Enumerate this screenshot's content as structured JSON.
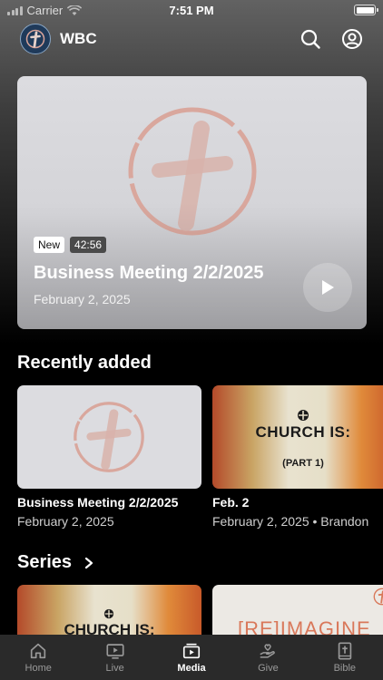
{
  "status_bar": {
    "carrier": "Carrier",
    "time": "7:51 PM"
  },
  "header": {
    "title": "WBC"
  },
  "hero": {
    "badge_new": "New",
    "duration": "42:56",
    "title": "Business Meeting 2/2/2025",
    "date": "February 2, 2025"
  },
  "recently_added": {
    "heading": "Recently added",
    "items": [
      {
        "title": "Business Meeting 2/2/2025",
        "meta": "February 2, 2025"
      },
      {
        "title": "Feb. 2",
        "meta": "February 2, 2025 • Brandon",
        "thumb_line1": "CHURCH IS:",
        "thumb_line2": "(PART 1)"
      }
    ]
  },
  "series": {
    "heading": "Series",
    "items": [
      {
        "thumb_text": "CHURCH IS:"
      },
      {
        "thumb_text": "[RE]IMAGINE"
      }
    ]
  },
  "tabs": [
    {
      "label": "Home",
      "icon": "home-icon"
    },
    {
      "label": "Live",
      "icon": "live-icon"
    },
    {
      "label": "Media",
      "icon": "media-icon",
      "active": true
    },
    {
      "label": "Give",
      "icon": "give-icon"
    },
    {
      "label": "Bible",
      "icon": "bible-icon"
    }
  ],
  "colors": {
    "background": "#000000",
    "tabbar": "#2a2a2a",
    "logo_accent": "#d9a49a"
  }
}
